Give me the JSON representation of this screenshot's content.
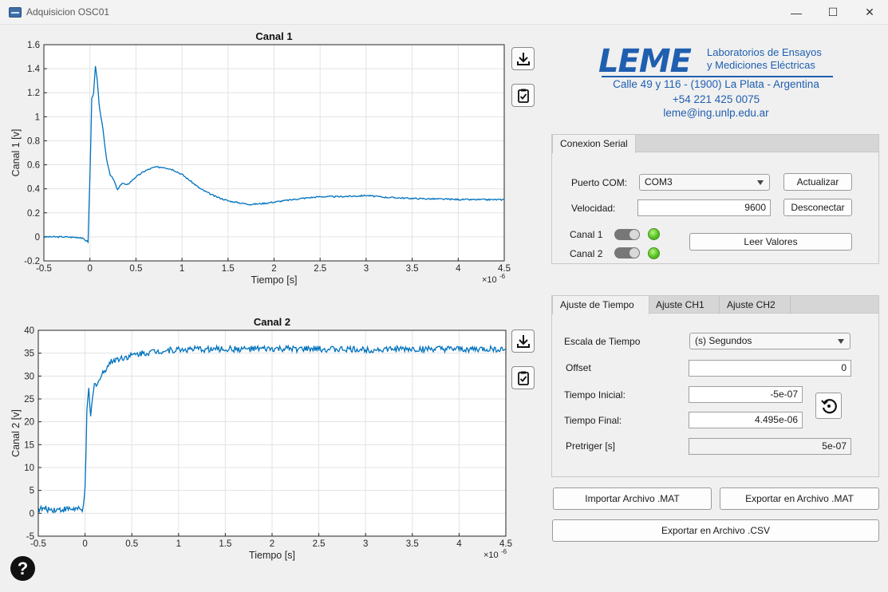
{
  "window": {
    "title": "Adquisicion OSC01",
    "minimize": "—",
    "maximize": "☐",
    "close": "✕"
  },
  "plots": [
    {
      "title": "Canal 1",
      "ylabel": "Canal 1  [v]",
      "xlabel": "Tiempo [s]",
      "exponent": "×10",
      "exponent_power": "-6"
    },
    {
      "title": "Canal 2",
      "ylabel": "Canal 2  [v]",
      "xlabel": "Tiempo [s]",
      "exponent": "×10",
      "exponent_power": "-6"
    }
  ],
  "chart_data": [
    {
      "type": "line",
      "title": "Canal 1",
      "xlabel": "Tiempo [s]",
      "ylabel": "Canal 1  [v]",
      "x_scale_label": "×10^-6",
      "xlim": [
        -0.5,
        4.5
      ],
      "ylim": [
        -0.2,
        1.6
      ],
      "xticks": [
        "-0.5",
        "0",
        "0.5",
        "1",
        "1.5",
        "2",
        "2.5",
        "3",
        "3.5",
        "4",
        "4.5"
      ],
      "yticks": [
        "-0.2",
        "0",
        "0.2",
        "0.4",
        "0.6",
        "0.8",
        "1",
        "1.2",
        "1.4",
        "1.6"
      ],
      "grid": true,
      "color": "#0072bd",
      "series": [
        {
          "x": [
            -0.5,
            -0.3,
            -0.1,
            -0.02,
            0.0,
            0.02,
            0.04,
            0.06,
            0.08,
            0.1,
            0.14,
            0.18,
            0.22,
            0.26,
            0.3,
            0.35,
            0.4,
            0.5,
            0.6,
            0.7,
            0.8,
            0.9,
            1.0,
            1.1,
            1.2,
            1.35,
            1.5,
            1.65,
            1.75,
            1.9,
            2.1,
            2.3,
            2.5,
            2.7,
            2.9,
            3.0,
            3.2,
            3.5,
            3.8,
            4.1,
            4.5
          ],
          "y": [
            0.0,
            0.0,
            -0.005,
            -0.04,
            0.5,
            1.15,
            1.2,
            1.42,
            1.3,
            1.1,
            0.9,
            0.65,
            0.52,
            0.47,
            0.39,
            0.45,
            0.43,
            0.5,
            0.55,
            0.58,
            0.58,
            0.56,
            0.52,
            0.46,
            0.4,
            0.34,
            0.3,
            0.28,
            0.27,
            0.28,
            0.3,
            0.32,
            0.335,
            0.335,
            0.34,
            0.345,
            0.33,
            0.32,
            0.315,
            0.31,
            0.31
          ]
        }
      ]
    },
    {
      "type": "line",
      "title": "Canal 2",
      "xlabel": "Tiempo [s]",
      "ylabel": "Canal 2  [v]",
      "x_scale_label": "×10^-6",
      "xlim": [
        -0.5,
        4.5
      ],
      "ylim": [
        -5,
        40
      ],
      "xticks": [
        "-0.5",
        "0",
        "0.5",
        "1",
        "1.5",
        "2",
        "2.5",
        "3",
        "3.5",
        "4",
        "4.5"
      ],
      "yticks": [
        "-5",
        "0",
        "5",
        "10",
        "15",
        "20",
        "25",
        "30",
        "35",
        "40"
      ],
      "grid": true,
      "color": "#0072bd",
      "series": [
        {
          "x": [
            -0.5,
            -0.3,
            -0.1,
            -0.03,
            0.0,
            0.02,
            0.04,
            0.06,
            0.08,
            0.1,
            0.15,
            0.2,
            0.25,
            0.3,
            0.4,
            0.5,
            0.6,
            0.8,
            1.0,
            1.5,
            2.0,
            2.5,
            3.0,
            3.5,
            4.0,
            4.5
          ],
          "y": [
            1.0,
            0.8,
            1.0,
            0.5,
            5.0,
            22.0,
            27.0,
            21.0,
            25.0,
            28.0,
            29.0,
            31.0,
            32.5,
            33.5,
            34.0,
            34.5,
            35.0,
            35.5,
            35.8,
            35.9,
            35.9,
            35.9,
            35.8,
            35.9,
            35.8,
            35.9
          ]
        }
      ]
    }
  ],
  "toolbar": {
    "export_icon": "download-icon",
    "copy_icon": "clipboard-check-icon"
  },
  "logo": {
    "brand": "LEME",
    "lab_line1": "Laboratorios de Ensayos",
    "lab_line2": "y  Mediciones  Eléctricas",
    "address": "Calle 49 y 116 - (1900) La Plata - Argentina",
    "phone": "+54 221 425 0075",
    "email": "leme@ing.unlp.edu.ar",
    "color": "#1f5fb0"
  },
  "serial": {
    "tab": "Conexion Serial",
    "port_label": "Puerto COM:",
    "port_value": "COM3",
    "refresh_button": "Actualizar",
    "speed_label": "Velocidad:",
    "speed_value": "9600",
    "disconnect_button": "Desconectar",
    "ch1_label": "Canal 1",
    "ch2_label": "Canal 2",
    "read_button": "Leer Valores"
  },
  "timing": {
    "tabs": [
      "Ajuste de Tiempo",
      "Ajuste CH1",
      "Ajuste CH2"
    ],
    "scale_label": "Escala de Tiempo",
    "scale_value": "(s) Segundos",
    "offset_label": "Offset",
    "offset_value": "0",
    "start_label": "Tiempo Inicial:",
    "start_value": "-5e-07",
    "end_label": "Tiempo Final:",
    "end_value": "4.495e-06",
    "pretrigger_label": "Pretriger [s]",
    "pretrigger_value": "5e-07",
    "reset_icon": "reset-icon"
  },
  "actions": {
    "import_mat": "Importar Archivo .MAT",
    "export_mat": "Exportar en Archivo .MAT",
    "export_csv": "Exportar en Archivo .CSV"
  },
  "help": "?"
}
